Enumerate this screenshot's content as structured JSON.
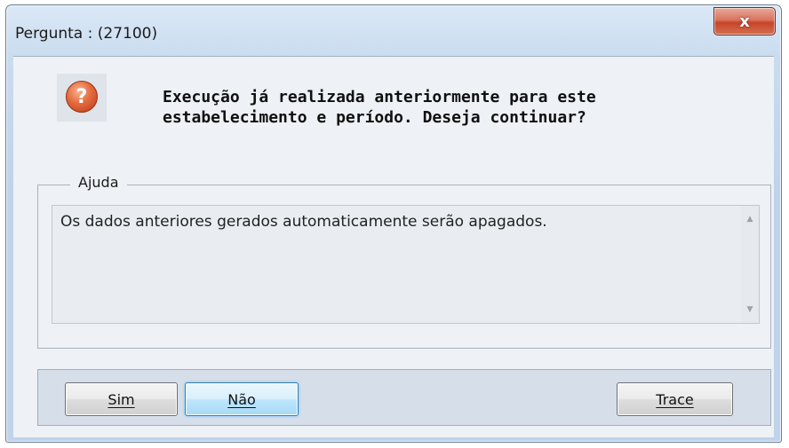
{
  "window": {
    "title": "Pergunta : (27100)",
    "close_label": "x"
  },
  "message": {
    "icon": "question-icon",
    "icon_glyph": "?",
    "text": "Execução já realizada anteriormente para este estabelecimento e período. Deseja continuar?"
  },
  "help": {
    "legend": "Ajuda",
    "text": "Os dados anteriores gerados automaticamente serão apagados.",
    "scroll_up_glyph": "▲",
    "scroll_down_glyph": "▼"
  },
  "buttons": {
    "sim": "Sim",
    "nao": "Não",
    "trace": "Trace"
  },
  "colors": {
    "focused_button_border": "#3c7fb1",
    "close_button": "#c5442a",
    "question_icon": "#e46a3e"
  }
}
